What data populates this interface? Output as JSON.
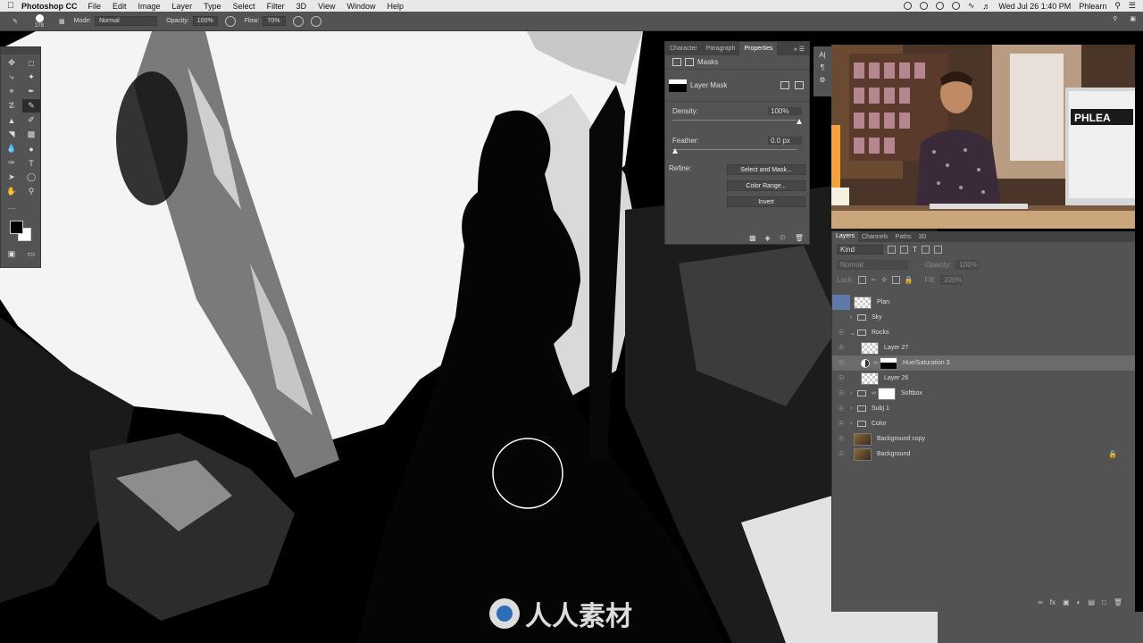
{
  "menubar": {
    "app_name": "Photoshop CC",
    "items": [
      "File",
      "Edit",
      "Image",
      "Layer",
      "Type",
      "Select",
      "Filter",
      "3D",
      "View",
      "Window",
      "Help"
    ],
    "datetime": "Wed Jul 26  1:40 PM",
    "user": "Phlearn"
  },
  "options": {
    "brush_size": "278",
    "mode_label": "Mode:",
    "mode_value": "Normal",
    "opacity_label": "Opacity:",
    "opacity_value": "100%",
    "flow_label": "Flow:",
    "flow_value": "70%"
  },
  "properties": {
    "tabs": [
      "Character",
      "Paragraph",
      "Properties"
    ],
    "section": "Masks",
    "mask_name": "Layer Mask",
    "density_label": "Density:",
    "density_value": "100%",
    "density_level": 1.0,
    "feather_label": "Feather:",
    "feather_value": "0.0 px",
    "feather_level": 0.0,
    "refine_label": "Refine:",
    "buttons": [
      "Select and Mask...",
      "Color Range...",
      "Invert"
    ]
  },
  "layers_panel": {
    "tabs": [
      "Layers",
      "Channels",
      "Paths",
      "3D"
    ],
    "kind_label": "Kind",
    "blend_mode": "Normal",
    "opacity_label": "Opacity:",
    "opacity_value": "100%",
    "lock_label": "Lock:",
    "fill_label": "Fill:",
    "fill_value": "100%",
    "layers": [
      {
        "name": "Plan",
        "type": "layer"
      },
      {
        "name": "Sky",
        "type": "group"
      },
      {
        "name": "Rocks",
        "type": "group-open"
      },
      {
        "name": "Layer 27",
        "type": "layer"
      },
      {
        "name": "Hue/Saturation 3",
        "type": "adjustment"
      },
      {
        "name": "Layer 26",
        "type": "layer"
      },
      {
        "name": "Softbox",
        "type": "group-mask"
      },
      {
        "name": "Subj 1",
        "type": "group"
      },
      {
        "name": "Color",
        "type": "group"
      },
      {
        "name": "Background copy",
        "type": "photo"
      },
      {
        "name": "Background",
        "type": "photo-locked"
      }
    ]
  },
  "webcam": {
    "sign_text": "PHLEA"
  },
  "watermark": {
    "text": "人人素材"
  },
  "colors": {
    "panel": "#535353",
    "panel_dark": "#424242",
    "selection": "#6b6b6b",
    "accent_blue": "#5f79a8"
  }
}
